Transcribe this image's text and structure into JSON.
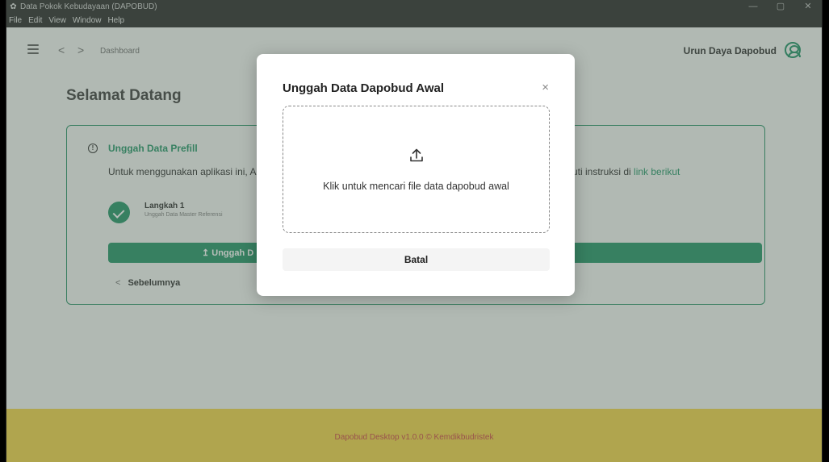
{
  "titlebar": {
    "title": "Data Pokok Kebudayaan (DAPOBUD)",
    "controls": [
      "—",
      "▢",
      "✕"
    ]
  },
  "menubar": {
    "items": [
      "File",
      "Edit",
      "View",
      "Window",
      "Help"
    ]
  },
  "appbar": {
    "breadcrumb": "Dashboard",
    "user_name": "Urun Daya Dapobud",
    "back_arrow": "<",
    "forward_arrow": ">"
  },
  "page": {
    "title": "Selamat Datang",
    "card": {
      "heading": "Unggah Data Prefill",
      "description_left": "Untuk menggunakan aplikasi ini, A",
      "description_right": "uti instruksi di ",
      "link": "link berikut",
      "step": {
        "title": "Langkah 1",
        "subtitle": "Unggah Data Master Referensi"
      },
      "upload_button": "↥  Unggah D",
      "prev_button": "Sebelumnya"
    }
  },
  "footer": {
    "text": "Dapobud Desktop v1.0.0 © Kemdikbudristek"
  },
  "modal": {
    "title": "Unggah Data Dapobud Awal",
    "close": "×",
    "dropzone_text": "Klik untuk mencari file data dapobud awal",
    "cancel": "Batal"
  },
  "colors": {
    "accent": "#178f5f",
    "footer": "#f3d13d",
    "footer_text": "#c83a3a"
  }
}
